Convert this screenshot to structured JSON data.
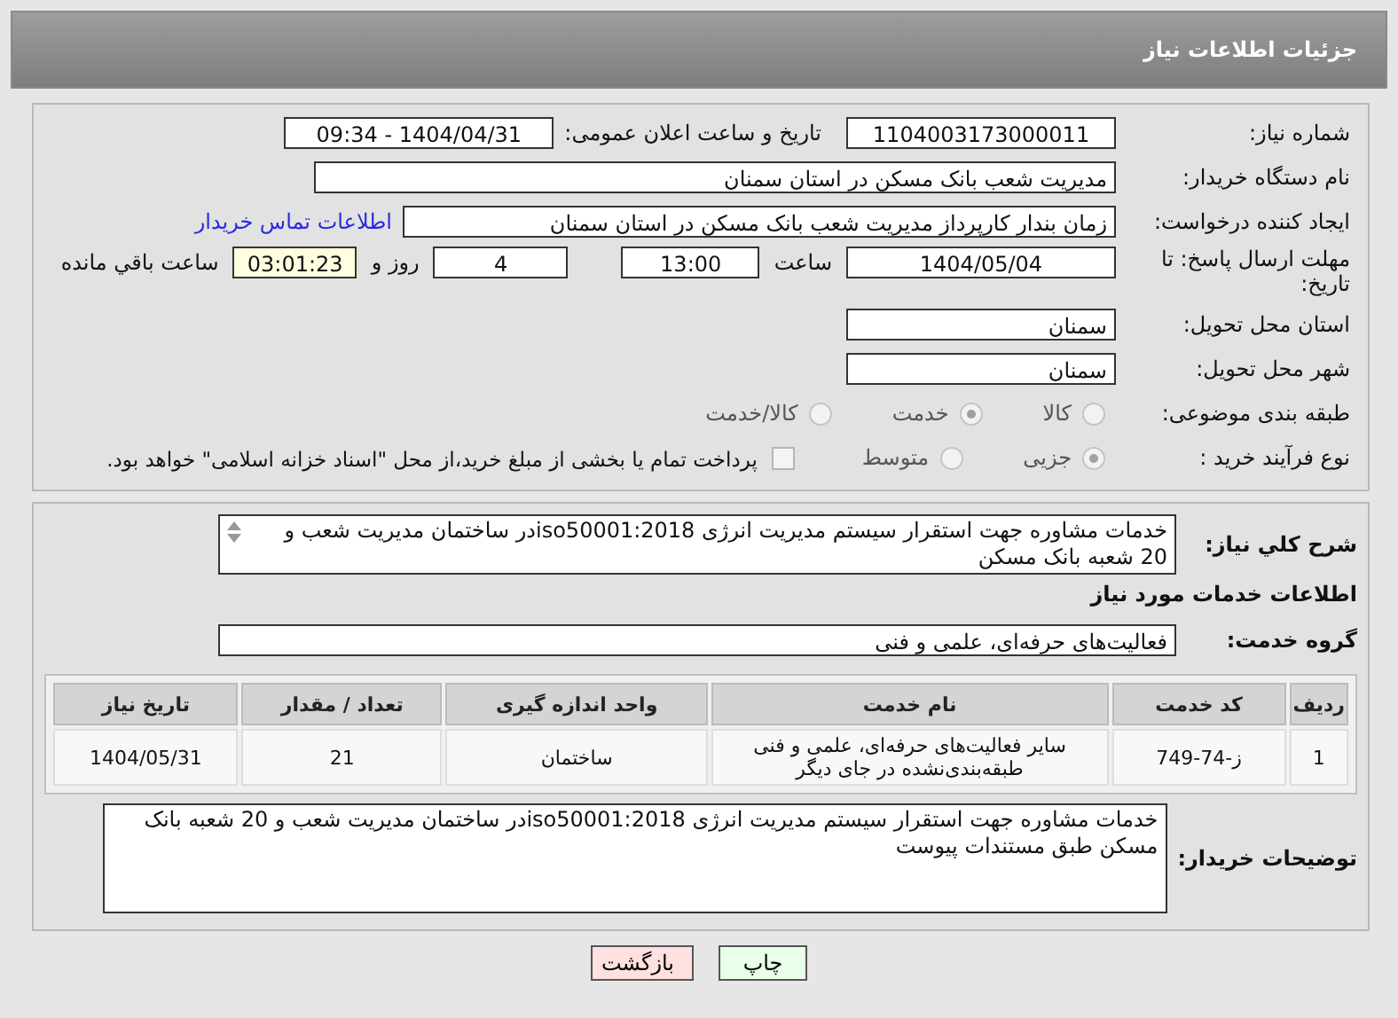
{
  "header": {
    "title": "جزئیات اطلاعات نیاز"
  },
  "need_number": {
    "label": "شماره نیاز:",
    "value": "1104003173000011"
  },
  "announce": {
    "label": "تاریخ و ساعت اعلان عمومی:",
    "value": "1404/04/31 - 09:34"
  },
  "buyer": {
    "label": "نام دستگاه خریدار:",
    "value": "مدیریت شعب بانک مسکن در استان سمنان"
  },
  "creator": {
    "label": "ایجاد کننده درخواست:",
    "value": "زمان بندار کارپرداز مدیریت شعب بانک مسکن در استان سمنان",
    "link": "اطلاعات تماس خریدار"
  },
  "deadline": {
    "label": "مهلت ارسال پاسخ: تا تاریخ:",
    "date": "1404/05/04",
    "time_label": "ساعت",
    "time": "13:00",
    "days": "4",
    "days_label": "روز و",
    "remaining": "03:01:23",
    "remaining_label": "ساعت باقي مانده"
  },
  "province": {
    "label": "استان محل تحویل:",
    "value": "سمنان"
  },
  "city": {
    "label": "شهر محل تحویل:",
    "value": "سمنان"
  },
  "category": {
    "label": "طبقه بندی موضوعی:",
    "options": [
      {
        "label": "کالا",
        "selected": false
      },
      {
        "label": "خدمت",
        "selected": true
      },
      {
        "label": "کالا/خدمت",
        "selected": false
      }
    ]
  },
  "purchase_type": {
    "label": "نوع فرآیند خرید :",
    "options": [
      {
        "label": "جزیی",
        "selected": true
      },
      {
        "label": "متوسط",
        "selected": false
      }
    ],
    "payment": {
      "checked": false,
      "label": "پرداخت تمام یا بخشی از مبلغ خرید،از محل \"اسناد خزانه اسلامی\" خواهد بود."
    }
  },
  "summary": {
    "label": "شرح کلي نياز:",
    "value": "خدمات مشاوره جهت استقرار سیستم مدیریت انرژی iso50001:2018در ساختمان مدیریت شعب و 20 شعبه بانک مسکن"
  },
  "services_title": "اطلاعات خدمات مورد نیاز",
  "service_group": {
    "label": "گروه خدمت:",
    "value": "فعالیت‌های حرفه‌ای، علمی و فنی"
  },
  "table": {
    "columns": [
      "ردیف",
      "کد خدمت",
      "نام خدمت",
      "واحد اندازه گیری",
      "تعداد / مقدار",
      "تاریخ نیاز"
    ],
    "rows": [
      [
        "1",
        "ز-74-749",
        "سایر فعالیت‌های حرفه‌ای، علمی و فنی طبقه‌بندی‌نشده در جای دیگر",
        "ساختمان",
        "21",
        "1404/05/31"
      ]
    ]
  },
  "buyer_notes": {
    "label": "توضیحات خریدار:",
    "value": "خدمات مشاوره جهت استقرار سیستم مدیریت انرژی iso50001:2018در ساختمان مدیریت شعب و 20 شعبه بانک مسکن طبق مستندات پیوست"
  },
  "buttons": [
    {
      "label": "چاپ",
      "kind": "print"
    },
    {
      "label": "بازگشت",
      "kind": "back"
    }
  ]
}
